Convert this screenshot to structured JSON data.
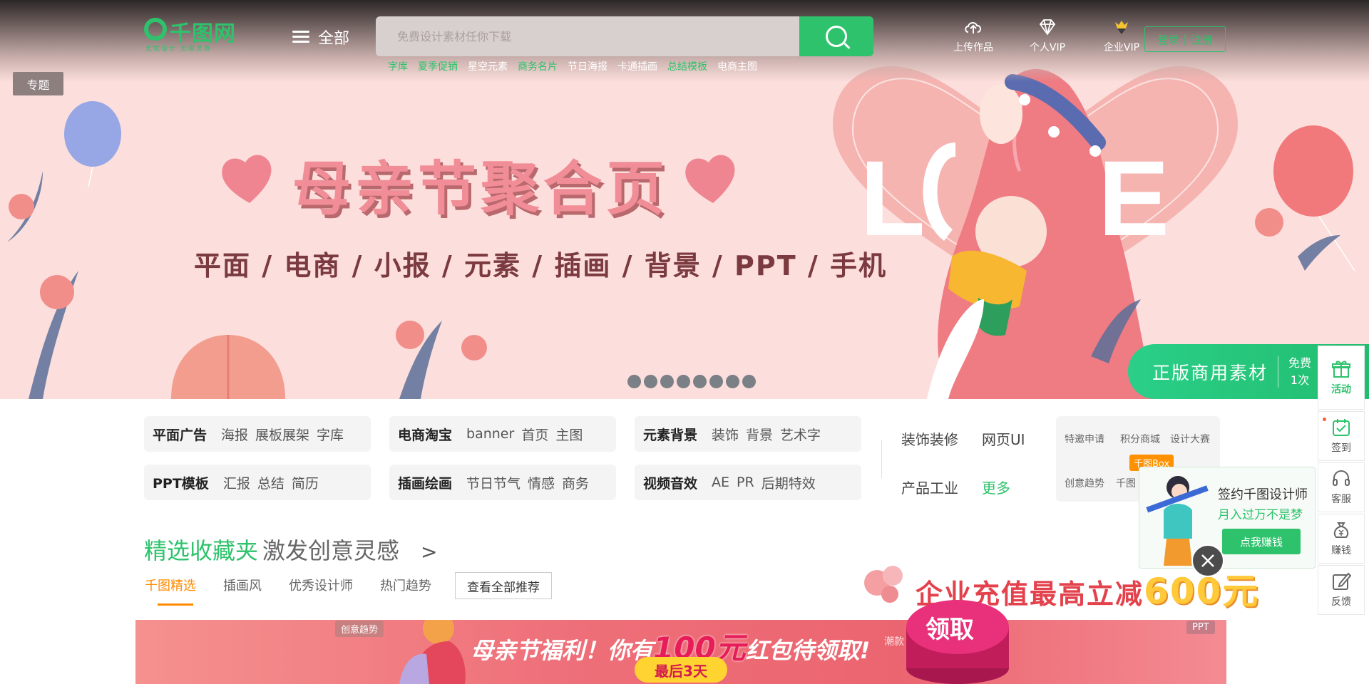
{
  "header": {
    "logo_text": "千图网",
    "logo_tagline": "无忧设计 无限灵感",
    "menu_all": "全部",
    "search_placeholder": "免费设计素材任你下载",
    "hot_words": [
      {
        "label": "字库",
        "highlight": true
      },
      {
        "label": "夏季促销",
        "highlight": true
      },
      {
        "label": "星空元素",
        "highlight": false
      },
      {
        "label": "商务名片",
        "highlight": true
      },
      {
        "label": "节日海报",
        "highlight": false
      },
      {
        "label": "卡通插画",
        "highlight": false
      },
      {
        "label": "总结模板",
        "highlight": true
      },
      {
        "label": "电商主图",
        "highlight": false
      }
    ],
    "tools": [
      {
        "label": "上传作品",
        "icon": "upload-cloud-icon"
      },
      {
        "label": "个人VIP",
        "icon": "diamond-icon"
      },
      {
        "label": "企业VIP",
        "icon": "crown-diamond-icon"
      }
    ],
    "login": "登录",
    "register": "注册",
    "login_sep": "|"
  },
  "banner": {
    "topic_tag": "专题",
    "title": "母亲节聚合页",
    "subtitle": "平面 / 电商 / 小报 / 元素 / 插画 / 背景 / PPT / 手机",
    "love_text": "LOVE",
    "dot_count": 8,
    "commerce_tab": "正版商用素材",
    "commerce_free_1": "免费",
    "commerce_free_2": "1次"
  },
  "categories": [
    {
      "title": "平面广告",
      "items": [
        "海报",
        "展板展架",
        "字库"
      ]
    },
    {
      "title": "电商淘宝",
      "items": [
        "banner",
        "首页",
        "主图"
      ]
    },
    {
      "title": "元素背景",
      "items": [
        "装饰",
        "背景",
        "艺术字"
      ]
    },
    {
      "title": "PPT模板",
      "items": [
        "汇报",
        "总结",
        "简历"
      ]
    },
    {
      "title": "插画绘画",
      "items": [
        "节日节气",
        "情感",
        "商务"
      ]
    },
    {
      "title": "视频音效",
      "items": [
        "AE",
        "PR",
        "后期特效"
      ]
    }
  ],
  "extra_links": {
    "decor": "装饰装修",
    "web_ui": "网页UI",
    "product": "产品工业",
    "more": "更多"
  },
  "mini_links": {
    "invite": "特邀申请",
    "points": "积分商城",
    "contest": "设计大赛",
    "trend": "创意趋势",
    "qiantu": "千图",
    "box_badge": "千图Box"
  },
  "section": {
    "title_green": "精选收藏夹",
    "title_gray": "激发创意灵感",
    "arrow": ">",
    "tabs": [
      "千图精选",
      "插画风",
      "优秀设计师",
      "热门趋势"
    ],
    "active_tab": 0,
    "view_all": "查看全部推荐"
  },
  "promos": {
    "enterprise_prefix": "企业充值最高立减",
    "enterprise_amount": "600元",
    "bar_prefix": "母亲节福利！你有",
    "bar_amount": "100元",
    "bar_suffix": "红包待领取!",
    "days_left": "最后3天",
    "claim": "领取",
    "badge_left": "创意趋势",
    "badge_right": "PPT",
    "peek_text": "潮款"
  },
  "designer_popup": {
    "line1": "签约千图设计师",
    "line2": "月入过万不是梦",
    "button": "点我赚钱"
  },
  "side_dock": [
    {
      "label": "活动",
      "icon": "gift-icon",
      "active": true
    },
    {
      "label": "签到",
      "icon": "checkin-icon",
      "active": false,
      "dot": true
    },
    {
      "label": "客服",
      "icon": "headset-icon",
      "active": false
    },
    {
      "label": "赚钱",
      "icon": "money-bag-icon",
      "active": false
    },
    {
      "label": "反馈",
      "icon": "edit-icon",
      "active": false
    }
  ],
  "colors": {
    "brand_green": "#2dc26b",
    "banner_bg": "#fcdfdc",
    "tab_active": "#ff8a00",
    "promo_red": "#e3424d"
  }
}
